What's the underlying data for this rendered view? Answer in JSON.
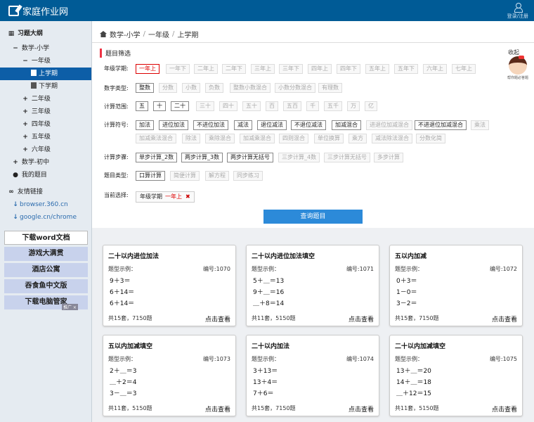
{
  "header": {
    "site_title": "家庭作业网",
    "login_label": "登录/注册"
  },
  "sidebar": {
    "section_title": "习题大纲",
    "level1": "数学-小学",
    "grade1": "一年级",
    "term_up": "上学期",
    "term_down": "下学期",
    "grade2": "二年级",
    "grade3": "三年级",
    "grade4": "四年级",
    "grade5": "五年级",
    "grade6": "六年级",
    "middle": "数学-初中",
    "my": "我的题目",
    "links_title": "友情链接",
    "link1": "browser.360.cn",
    "link2": "google.cn/chrome",
    "ad_buttons": [
      "下载word文档",
      "游戏大满贯",
      "酒店公寓",
      "吞食鱼中文版",
      "下载电脑管家"
    ],
    "ad_tag": "推广 ×"
  },
  "breadcrumb": {
    "root": "数学-小学",
    "grade": "一年级",
    "term": "上学期"
  },
  "filter": {
    "title": "题目筛选",
    "collapse_label": "收起",
    "mascot_caption": "帮你题必答题",
    "grade_label": "年级学期:",
    "grade_opts": [
      "一年上",
      "一年下",
      "二年上",
      "二年下",
      "三年上",
      "三年下",
      "四年上",
      "四年下",
      "五年上",
      "五年下",
      "六年上",
      "七年上"
    ],
    "numtype_label": "数字类型:",
    "numtype_opts": [
      "整数",
      "分数",
      "小数",
      "负数",
      "整数小数混合",
      "小数分数混合",
      "有理数"
    ],
    "range_label": "计算范围:",
    "range_opts": [
      "五",
      "十",
      "二十",
      "三十",
      "四十",
      "五十",
      "百",
      "五百",
      "千",
      "五千",
      "万",
      "亿"
    ],
    "op_label": "计算符号:",
    "op_row1": [
      "加法",
      "进位加法",
      "不进位加法",
      "减法",
      "退位减法",
      "不退位减法",
      "加减混合",
      "进退位加减混合",
      "不进退位加减混合",
      "乘法"
    ],
    "op_row2": [
      "加减乘法混合",
      "除法",
      "乘除混合",
      "加减乘混合",
      "四则混合",
      "单位换算",
      "乘方",
      "减法除法混合",
      "分数化简"
    ],
    "step_label": "计算步骤:",
    "step_opts": [
      "单步计算_2数",
      "两步计算_3数",
      "两步计算无括号",
      "三步计算_4数",
      "三步计算无括号",
      "多步计算"
    ],
    "qtype_label": "题目类型:",
    "qtype_opts": [
      "口算计算",
      "简便计算",
      "解方程",
      "同步练习"
    ],
    "current_label": "当前选择:",
    "current_key": "年级学期",
    "current_val": "一年上",
    "remove_icon": "✖",
    "query_label": "查询题目"
  },
  "cards": [
    {
      "title": "二十以内进位加法",
      "sample_label": "题型示例：",
      "id": "编号:1070",
      "examples": [
        "9＋3＝",
        "6＋14＝",
        "6＋14＝"
      ],
      "stats": "共15套，7150题",
      "view": "点击查看"
    },
    {
      "title": "二十以内进位加法填空",
      "sample_label": "题型示例：",
      "id": "编号:1071",
      "examples": [
        "5＋＿＝13",
        "9＋＿＝16",
        "＿＋8＝14"
      ],
      "stats": "共11套，5150题",
      "view": "点击查看"
    },
    {
      "title": "五以内加减",
      "sample_label": "题型示例：",
      "id": "编号:1072",
      "examples": [
        "0＋3＝",
        "1－0＝",
        "3－2＝"
      ],
      "stats": "共15套，7150题",
      "view": "点击查看"
    },
    {
      "title": "五以内加减填空",
      "sample_label": "题型示例：",
      "id": "编号:1073",
      "examples": [
        "2＋＿＝3",
        "＿＋2＝4",
        "3－＿＝3"
      ],
      "stats": "共11套，5150题",
      "view": "点击查看"
    },
    {
      "title": "二十以内加法",
      "sample_label": "题型示例：",
      "id": "编号:1074",
      "examples": [
        "3＋13＝",
        "13＋4＝",
        "7＋6＝"
      ],
      "stats": "共15套，7150题",
      "view": "点击查看"
    },
    {
      "title": "二十以内加减填空",
      "sample_label": "题型示例：",
      "id": "编号:1075",
      "examples": [
        "13＋＿＝20",
        "14＋＿＝18",
        "＿＋12＝15"
      ],
      "stats": "共11套，5150题",
      "view": "点击查看"
    }
  ]
}
